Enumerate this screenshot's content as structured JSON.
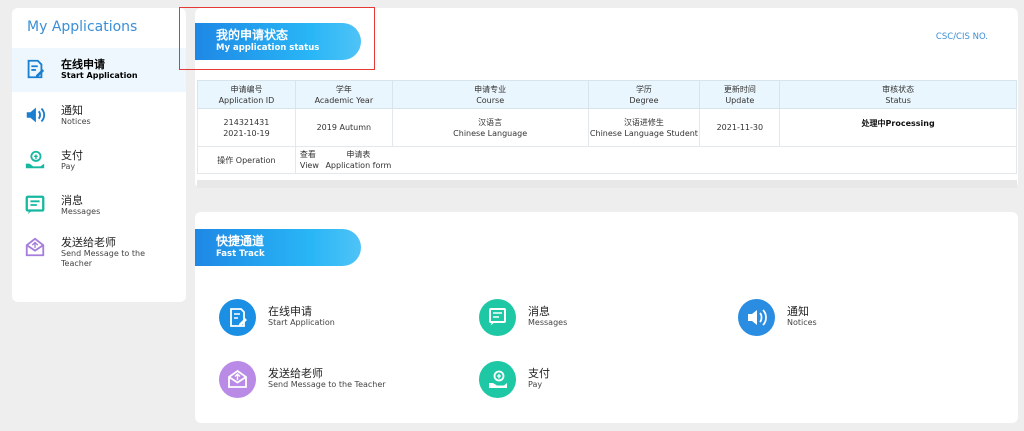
{
  "sidebar": {
    "title": "My Applications",
    "items": [
      {
        "zh": "在线申请",
        "en": "Start Application",
        "icon": "edit-document-icon"
      },
      {
        "zh": "通知",
        "en": "Notices",
        "icon": "speaker-icon"
      },
      {
        "zh": "支付",
        "en": "Pay",
        "icon": "pay-hand-icon"
      },
      {
        "zh": "消息",
        "en": "Messages",
        "icon": "message-icon"
      },
      {
        "zh": "发送给老师",
        "en": "Send Message to the Teacher",
        "icon": "send-envelope-icon"
      }
    ]
  },
  "status_section": {
    "title_zh": "我的申请状态",
    "title_en": "My application status",
    "csc_label": "CSC/CIS NO.",
    "headers": [
      {
        "zh": "申请编号",
        "en": "Application ID"
      },
      {
        "zh": "学年",
        "en": "Academic Year"
      },
      {
        "zh": "申请专业",
        "en": "Course"
      },
      {
        "zh": "学历",
        "en": "Degree"
      },
      {
        "zh": "更新时间",
        "en": "Update"
      },
      {
        "zh": "审核状态",
        "en": "Status"
      }
    ],
    "row": {
      "id": "214321431",
      "id_date": "2021-10-19",
      "year": "2019 Autumn",
      "course_zh": "汉语言",
      "course_en": "Chinese Language",
      "degree_zh": "汉语进修生",
      "degree_en": "Chinese Language Student",
      "update": "2021-11-30",
      "status": "处理中Processing"
    },
    "ops": {
      "label": "操作 Operation",
      "view_zh": "查看",
      "view_en": "View",
      "form_zh": "申请表",
      "form_en": "Application form"
    }
  },
  "fast_track": {
    "title_zh": "快捷通道",
    "title_en": "Fast Track",
    "items": [
      {
        "zh": "在线申请",
        "en": "Start Application",
        "icon": "edit-document-icon",
        "color": "#1a8fe3"
      },
      {
        "zh": "消息",
        "en": "Messages",
        "icon": "message-icon",
        "color": "#1ec8a5"
      },
      {
        "zh": "通知",
        "en": "Notices",
        "icon": "speaker-icon",
        "color": "#2a8de2"
      },
      {
        "zh": "发送给老师",
        "en": "Send Message to the Teacher",
        "icon": "send-envelope-icon",
        "color": "#b98be6"
      },
      {
        "zh": "支付",
        "en": "Pay",
        "icon": "pay-hand-icon",
        "color": "#1ec8a5"
      }
    ]
  },
  "colors": {
    "accent": "#3a8fd6",
    "teal": "#1ec8a5",
    "highlight_box": "#e53935"
  }
}
